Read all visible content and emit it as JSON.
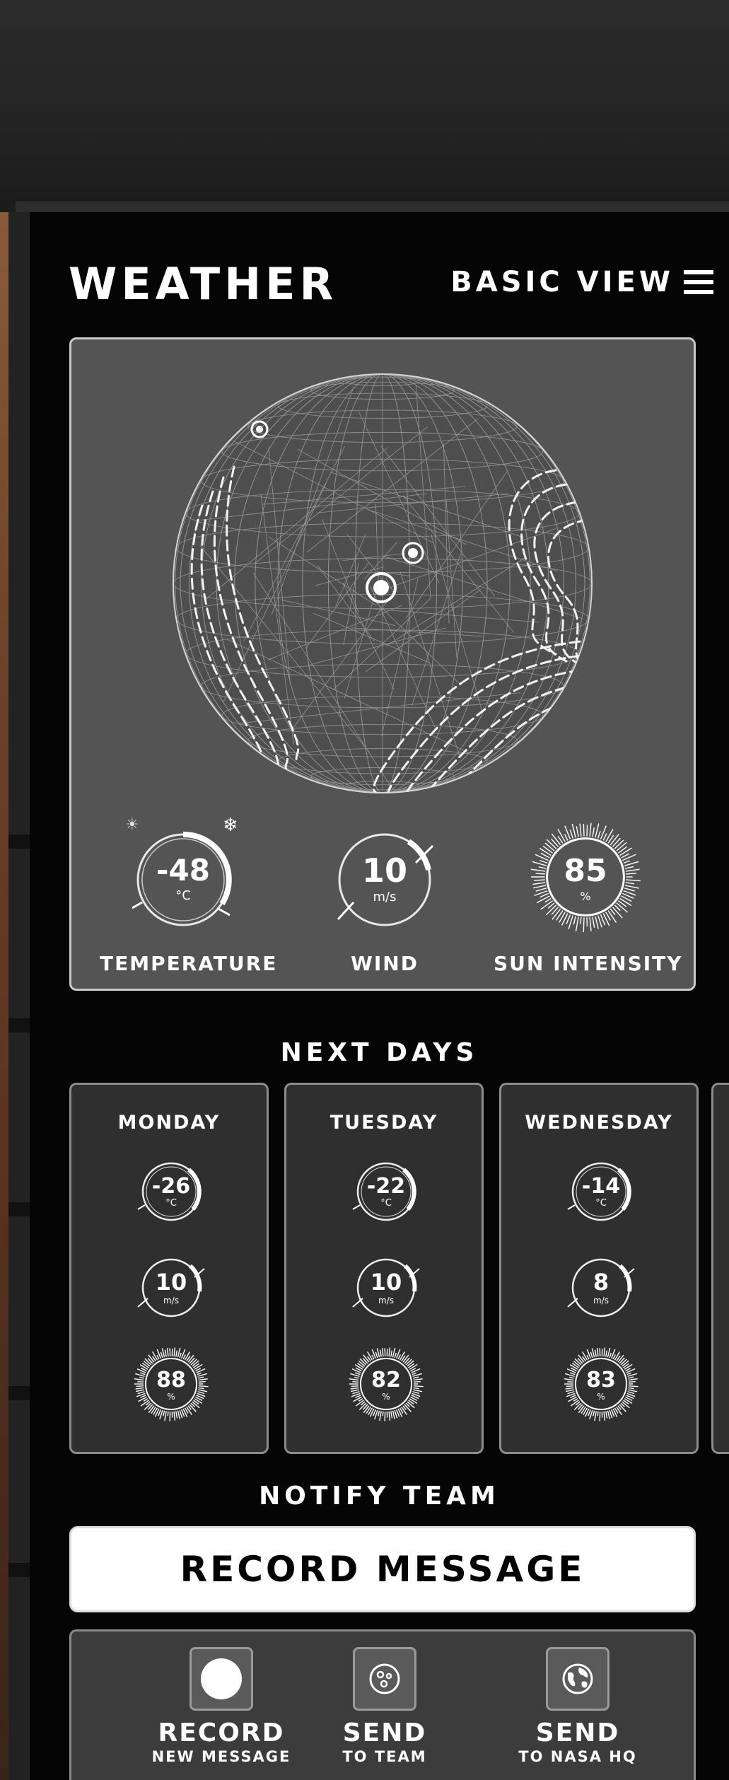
{
  "panel": {
    "title": "WEATHER",
    "view_toggle_label": "BASIC VIEW"
  },
  "current": {
    "temperature": {
      "value": "-48",
      "unit": "°C",
      "label": "TEMPERATURE"
    },
    "wind": {
      "value": "10",
      "unit": "m/s",
      "label": "WIND"
    },
    "sun": {
      "value": "85",
      "unit": "%",
      "label": "SUN INTENSITY"
    }
  },
  "next_days": {
    "heading": "NEXT DAYS",
    "days": [
      {
        "name": "MONDAY",
        "temp": "-26",
        "temp_unit": "°C",
        "wind": "10",
        "wind_unit": "m/s",
        "sun": "88",
        "sun_unit": "%"
      },
      {
        "name": "TUESDAY",
        "temp": "-22",
        "temp_unit": "°C",
        "wind": "10",
        "wind_unit": "m/s",
        "sun": "82",
        "sun_unit": "%"
      },
      {
        "name": "WEDNESDAY",
        "temp": "-14",
        "temp_unit": "°C",
        "wind": "8",
        "wind_unit": "m/s",
        "sun": "83",
        "sun_unit": "%"
      }
    ]
  },
  "notify": {
    "heading": "NOTIFY TEAM",
    "record_button": "RECORD MESSAGE",
    "actions": [
      {
        "title": "RECORD",
        "subtitle": "NEW MESSAGE",
        "icon": "record-circle-icon"
      },
      {
        "title": "SEND",
        "subtitle": "TO TEAM",
        "icon": "team-icon"
      },
      {
        "title": "SEND",
        "subtitle": "TO NASA HQ",
        "icon": "earth-icon"
      }
    ]
  }
}
